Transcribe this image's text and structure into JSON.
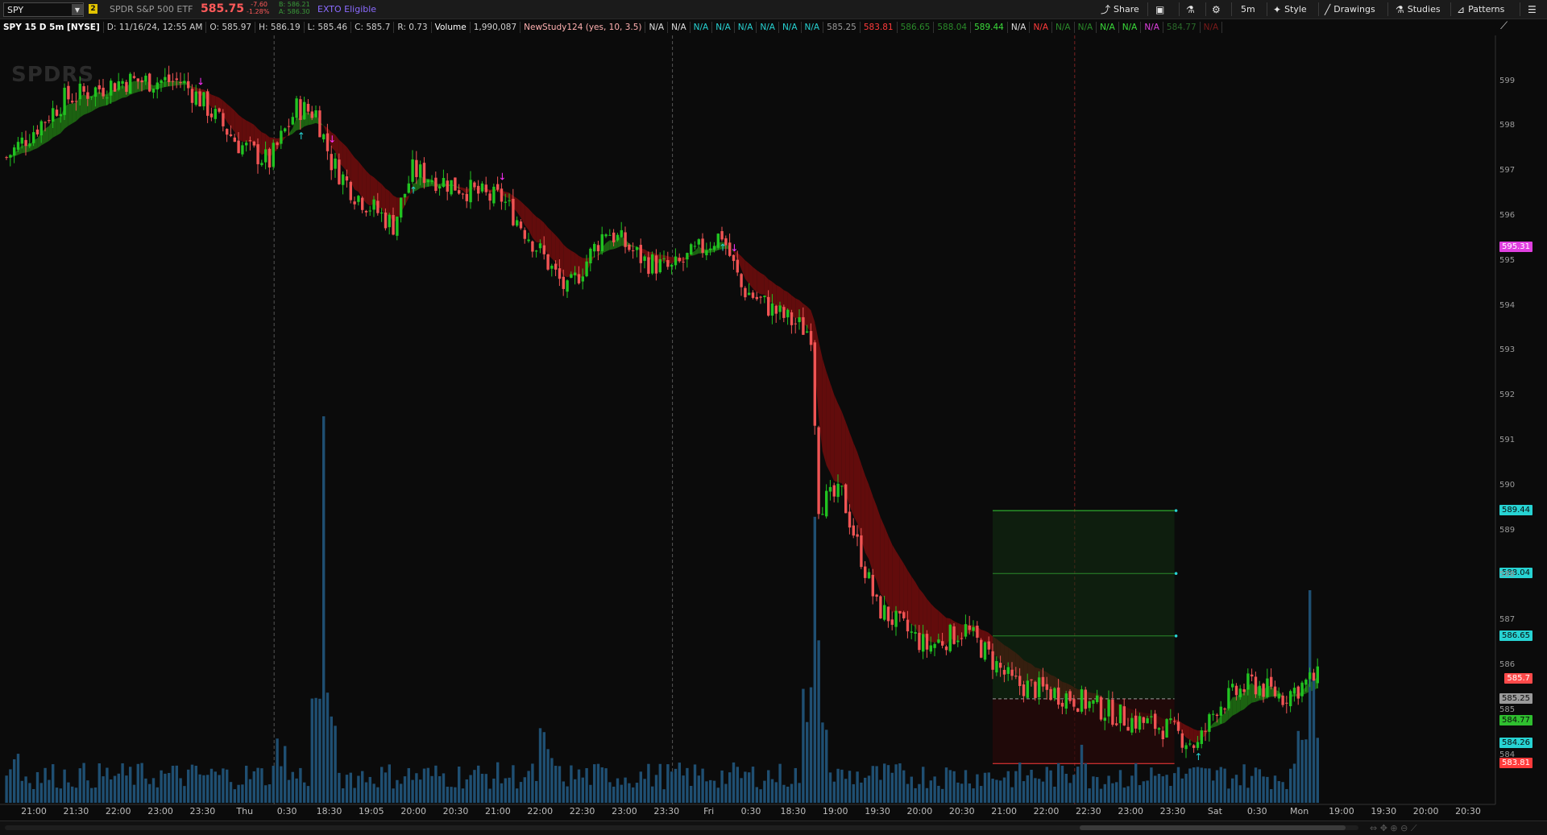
{
  "topbar": {
    "symbol": "SPY",
    "link_group": "2",
    "description": "SPDR S&P 500 ETF",
    "last": "585.75",
    "net_change": "-7.60",
    "pct_change": "-1.28%",
    "bid": "B: 586.21",
    "ask": "A: 586.30",
    "exto": "EXTO Eligible",
    "share": "Share",
    "aggregation": "5m",
    "style": "Style",
    "drawings": "Drawings",
    "studies": "Studies",
    "patterns": "Patterns"
  },
  "infobar": {
    "title": "SPY 15 D 5m [NYSE]",
    "date": "D: 11/16/24, 12:55 AM",
    "open": "O: 585.97",
    "high": "H: 586.19",
    "low": "L: 585.46",
    "close": "C: 585.7",
    "range": "R: 0.73",
    "volume_label": "Volume",
    "volume_value": "1,990,087",
    "study": "NewStudy124 (yes, 10, 3.5)",
    "study_values": [
      {
        "text": "N/A",
        "color": "#e0e0e0"
      },
      {
        "text": "N/A",
        "color": "#e0e0e0"
      },
      {
        "text": "N/A",
        "color": "#27d3d3"
      },
      {
        "text": "N/A",
        "color": "#27d3d3"
      },
      {
        "text": "N/A",
        "color": "#27d3d3"
      },
      {
        "text": "N/A",
        "color": "#27d3d3"
      },
      {
        "text": "N/A",
        "color": "#27d3d3"
      },
      {
        "text": "N/A",
        "color": "#27d3d3"
      },
      {
        "text": "585.25",
        "color": "#9a9a9a"
      },
      {
        "text": "583.81",
        "color": "#ff3b3b"
      },
      {
        "text": "586.65",
        "color": "#2a8a2a"
      },
      {
        "text": "588.04",
        "color": "#2a8a2a"
      },
      {
        "text": "589.44",
        "color": "#3bdc3b"
      },
      {
        "text": "N/A",
        "color": "#e0e0e0"
      },
      {
        "text": "N/A",
        "color": "#ff3b3b"
      },
      {
        "text": "N/A",
        "color": "#2a8a2a"
      },
      {
        "text": "N/A",
        "color": "#2a8a2a"
      },
      {
        "text": "N/A",
        "color": "#3bdc3b"
      },
      {
        "text": "N/A",
        "color": "#3bdc3b"
      },
      {
        "text": "N/A",
        "color": "#e040e0"
      },
      {
        "text": "584.77",
        "color": "#2a6a2a"
      },
      {
        "text": "N/A",
        "color": "#7a1a1a"
      }
    ]
  },
  "watermark": "SPDRS",
  "price_axis": {
    "ticks": [
      "599",
      "598",
      "597",
      "596",
      "595",
      "594",
      "593",
      "592",
      "591",
      "590",
      "589",
      "588",
      "587",
      "586",
      "585",
      "584"
    ],
    "labels": [
      {
        "text": "595.31",
        "price": 595.31,
        "bg": "#e040e0",
        "fg": "#ffffff"
      },
      {
        "text": "589.44",
        "price": 589.44,
        "bg": "#27d3d3",
        "fg": "#0b0b0b"
      },
      {
        "text": "588.04",
        "price": 588.04,
        "bg": "#27d3d3",
        "fg": "#0b0b0b"
      },
      {
        "text": "586.65",
        "price": 586.65,
        "bg": "#27d3d3",
        "fg": "#0b0b0b"
      },
      {
        "text": "585.7",
        "price": 585.7,
        "bg": "#ff4a4a",
        "fg": "#ffffff"
      },
      {
        "text": "585.25",
        "price": 585.25,
        "bg": "#9a9a9a",
        "fg": "#0b0b0b"
      },
      {
        "text": "584.77",
        "price": 584.77,
        "bg": "#2fbf2f",
        "fg": "#0b0b0b"
      },
      {
        "text": "584.26",
        "price": 584.26,
        "bg": "#27d3d3",
        "fg": "#0b0b0b"
      },
      {
        "text": "583.81",
        "price": 583.81,
        "bg": "#ff3b3b",
        "fg": "#ffffff"
      }
    ]
  },
  "time_axis": {
    "ticks": [
      "21:00",
      "21:30",
      "22:00",
      "23:00",
      "23:30",
      "Thu",
      "0:30",
      "18:30",
      "19:05",
      "20:00",
      "20:30",
      "21:00",
      "22:00",
      "22:30",
      "23:00",
      "23:30",
      "Fri",
      "0:30",
      "18:30",
      "19:00",
      "19:30",
      "20:00",
      "20:30",
      "21:00",
      "22:00",
      "22:30",
      "23:00",
      "23:30",
      "Sat",
      "0:30",
      "Mon",
      "19:00",
      "19:30",
      "20:00",
      "20:30"
    ]
  },
  "chart_data": {
    "type": "candlestick",
    "price_range": [
      583.6,
      599.8
    ],
    "trade_zone": {
      "entry": 585.25,
      "stop": 583.81,
      "target1": 586.65,
      "target2": 588.04,
      "target3": 589.44
    },
    "price_path": [
      {
        "bar": 0,
        "close": 597.3
      },
      {
        "bar": 15,
        "close": 598.6
      },
      {
        "bar": 30,
        "close": 599.0
      },
      {
        "bar": 45,
        "close": 599.0
      },
      {
        "bar": 50,
        "close": 598.6
      },
      {
        "bar": 60,
        "close": 597.6
      },
      {
        "bar": 68,
        "close": 597.2
      },
      {
        "bar": 75,
        "close": 598.4
      },
      {
        "bar": 80,
        "close": 598.3
      },
      {
        "bar": 84,
        "close": 597.2
      },
      {
        "bar": 90,
        "close": 596.5
      },
      {
        "bar": 100,
        "close": 595.8
      },
      {
        "bar": 105,
        "close": 597.0
      },
      {
        "bar": 112,
        "close": 596.8
      },
      {
        "bar": 125,
        "close": 596.4
      },
      {
        "bar": 128,
        "close": 596.4
      },
      {
        "bar": 138,
        "close": 595.2
      },
      {
        "bar": 145,
        "close": 594.3
      },
      {
        "bar": 155,
        "close": 595.7
      },
      {
        "bar": 165,
        "close": 595.0
      },
      {
        "bar": 172,
        "close": 594.8
      },
      {
        "bar": 185,
        "close": 595.6
      },
      {
        "bar": 190,
        "close": 594.4
      },
      {
        "bar": 200,
        "close": 593.8
      },
      {
        "bar": 208,
        "close": 593.4
      },
      {
        "bar": 210,
        "close": 589.6
      },
      {
        "bar": 216,
        "close": 589.8
      },
      {
        "bar": 225,
        "close": 587.3
      },
      {
        "bar": 238,
        "close": 586.4
      },
      {
        "bar": 248,
        "close": 586.8
      },
      {
        "bar": 260,
        "close": 585.6
      },
      {
        "bar": 275,
        "close": 585.3
      },
      {
        "bar": 290,
        "close": 584.8
      },
      {
        "bar": 300,
        "close": 584.6
      },
      {
        "bar": 308,
        "close": 584.2
      },
      {
        "bar": 313,
        "close": 585.1
      },
      {
        "bar": 322,
        "close": 585.6
      },
      {
        "bar": 330,
        "close": 585.3
      },
      {
        "bar": 338,
        "close": 585.7
      }
    ],
    "volume_spikes": [
      {
        "bar": 82,
        "value": 1.0
      },
      {
        "bar": 209,
        "value": 0.74
      },
      {
        "bar": 337,
        "value": 0.55
      }
    ]
  }
}
